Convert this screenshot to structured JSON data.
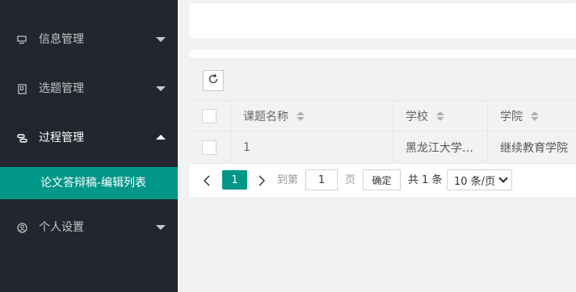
{
  "sidebar": {
    "items": [
      {
        "label": "信息管理",
        "icon": "monitor-icon",
        "expanded": false
      },
      {
        "label": "选题管理",
        "icon": "document-icon",
        "expanded": false
      },
      {
        "label": "过程管理",
        "icon": "link-icon",
        "expanded": true
      },
      {
        "label": "个人设置",
        "icon": "user-icon",
        "expanded": false
      }
    ],
    "active_sub_item": "论文答辩稿-编辑列表",
    "active_color": "#009688"
  },
  "table": {
    "columns": [
      "课题名称",
      "学校",
      "学院"
    ],
    "rows": [
      {
        "title": "1",
        "school": "黑龙江大学…",
        "college": "继续教育学院"
      }
    ]
  },
  "pagination": {
    "current_page": "1",
    "goto_label": "到第",
    "goto_value": "1",
    "page_unit": "页",
    "confirm_label": "确定",
    "total_text": "共 1 条",
    "page_size": "10 条/页"
  }
}
